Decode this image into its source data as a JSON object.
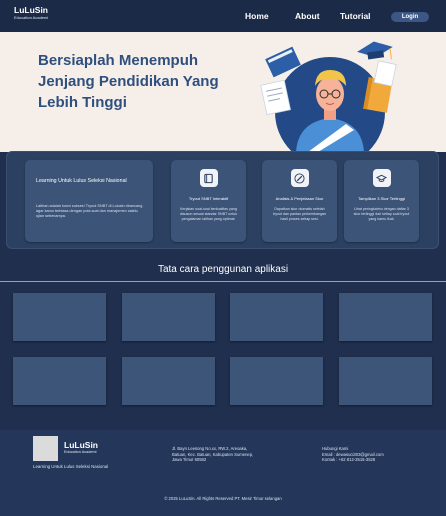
{
  "navbar": {
    "brand_name": "LuLuSin",
    "brand_sub": "Education Academi",
    "links": [
      {
        "label": "Home"
      },
      {
        "label": "About"
      },
      {
        "label": "Tutorial"
      }
    ],
    "login_label": "Login"
  },
  "hero": {
    "title": "Bersiaplah Menempuh Jenjang Pendidikan Yang Lebih Tinggi"
  },
  "features": {
    "main": {
      "title": "Learning Untuk Lulus Seleksi Nasional",
      "desc": "Latihan adalah kunci sukses! Tryout SNBT di Lulusin dirancang agar kamu terbiasa dengan pola soal dan manajemen waktu ujian sebenarnya."
    },
    "cards": [
      {
        "icon": "book-icon",
        "title": "Tryout SNBT Interaktif",
        "desc": "Kerjakan soal-soal berkualitas yang disusun sesuai standar SNBT untuk pengalaman latihan yang optimal."
      },
      {
        "icon": "pencil-icon",
        "title": "Analisis & Penjelasan Skor",
        "desc": "Dapatkan skor otomatis setelah tryout dan pantau perkembangan hasil proses setiap sesi."
      },
      {
        "icon": "graduation-cap-icon",
        "title": "Tampilkan 3 Skor Tertinggi",
        "desc": "Lihat peringkatmu dengan daftar 3 skor tertinggi dari setiap soal tryout yang kamu ikuti."
      }
    ]
  },
  "guide": {
    "title": "Tata cara penggunan aplikasi",
    "box_count_label": ""
  },
  "footer": {
    "brand_name": "LuLuSin",
    "brand_sub": "Education Academi",
    "tagline": "Learning Untuk Lulus Seleksi Nasional",
    "address": "Jl. Bayn Leesong No.xx, RW.2, Areoaka, Batuan, Kec. Batuan, Kabupaten Sumenep, Jawa Timur 60582",
    "contact_title": "Hubungi Kami",
    "email": "Email : dewasuci303@gmail.com",
    "phone": "Kontak : +62 812-3515-3528",
    "copyright": "© 2025 LuLuSin. All Rights Reserved PT. Mesir Timur selangan"
  },
  "colors": {
    "navy": "#1f2f4d",
    "card": "#3b5478",
    "hero_bg": "#f6efe9",
    "hero_title": "#2f4f7f"
  }
}
